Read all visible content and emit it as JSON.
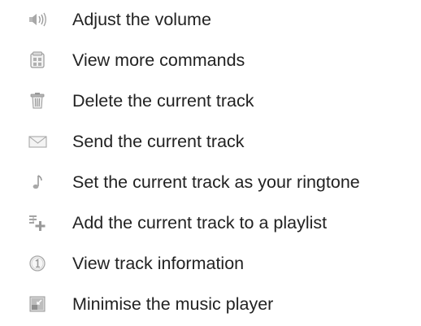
{
  "commands": [
    {
      "icon": "volume-icon",
      "label": "Adjust the volume"
    },
    {
      "icon": "more-commands-icon",
      "label": "View more commands"
    },
    {
      "icon": "trash-icon",
      "label": "Delete the current track"
    },
    {
      "icon": "envelope-icon",
      "label": "Send the current track"
    },
    {
      "icon": "music-note-icon",
      "label": "Set the current track as your ringtone"
    },
    {
      "icon": "playlist-add-icon",
      "label": "Add the current track to a playlist"
    },
    {
      "icon": "info-number-icon",
      "label": "View track information"
    },
    {
      "icon": "minimise-icon",
      "label": "Minimise the music player"
    }
  ]
}
